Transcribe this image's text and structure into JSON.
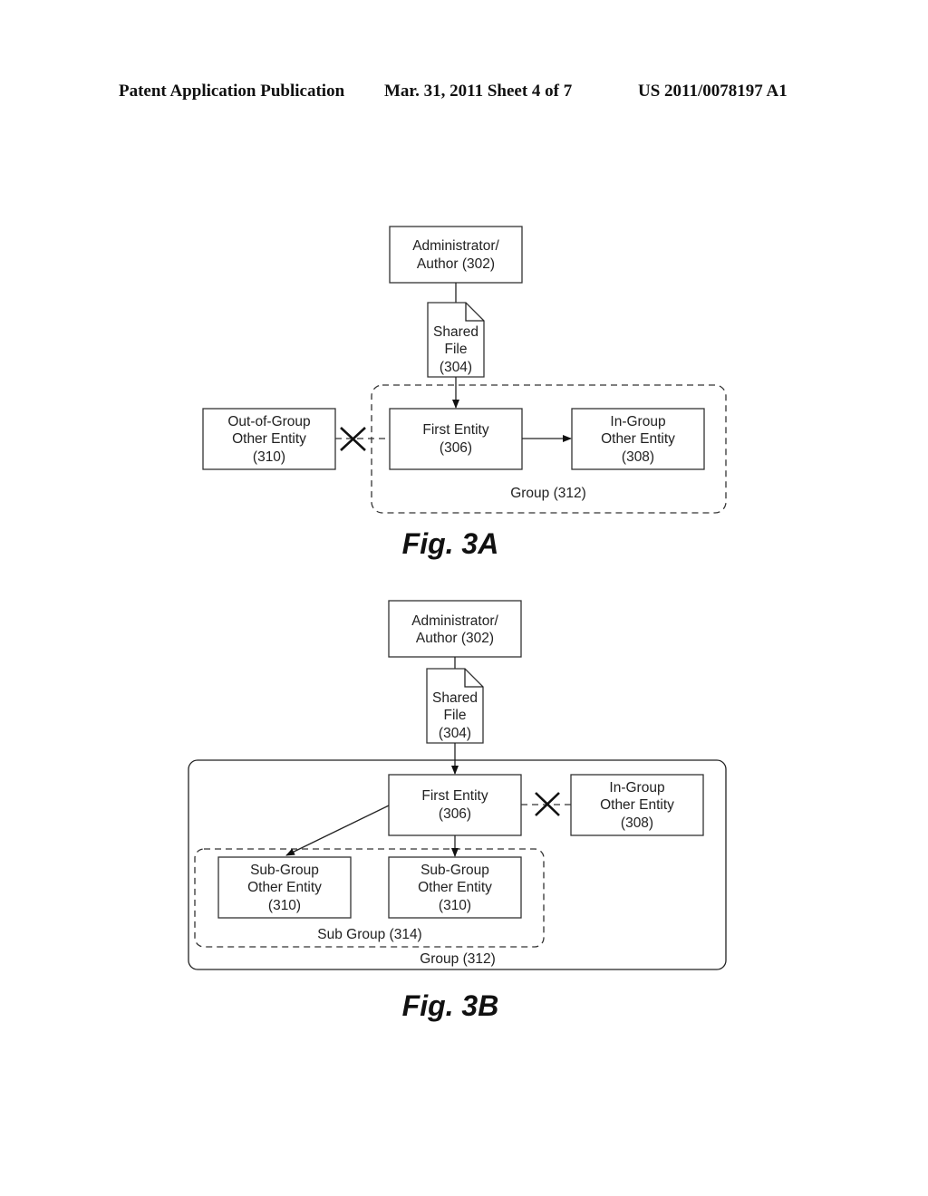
{
  "header": {
    "publication": "Patent Application Publication",
    "date_sheet": "Mar. 31, 2011  Sheet 4 of 7",
    "number": "US 2011/0078197 A1"
  },
  "fig3a": {
    "caption": "Fig. 3A",
    "admin": [
      "Administrator/",
      "Author (302)"
    ],
    "file": [
      "Shared",
      "File",
      "(304)"
    ],
    "out_group": [
      "Out-of-Group",
      "Other Entity",
      "(310)"
    ],
    "first": [
      "First Entity",
      "(306)"
    ],
    "in_group": [
      "In-Group",
      "Other Entity",
      "(308)"
    ],
    "group": "Group (312)"
  },
  "fig3b": {
    "caption": "Fig. 3B",
    "admin": [
      "Administrator/",
      "Author (302)"
    ],
    "file": [
      "Shared",
      "File",
      "(304)"
    ],
    "first": [
      "First Entity",
      "(306)"
    ],
    "in_group": [
      "In-Group",
      "Other Entity",
      "(308)"
    ],
    "sub1": [
      "Sub-Group",
      "Other Entity",
      "(310)"
    ],
    "sub2": [
      "Sub-Group",
      "Other Entity",
      "(310)"
    ],
    "subgroup": "Sub Group (314)",
    "group": "Group (312)"
  }
}
